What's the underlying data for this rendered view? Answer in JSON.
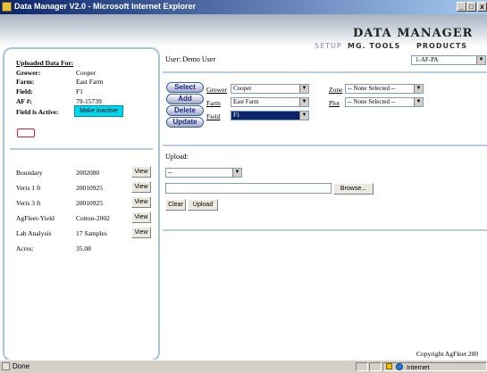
{
  "window": {
    "title": "Data Manager V2.0 - Microsoft Internet Explorer",
    "min": "_",
    "max": "□",
    "close": "x"
  },
  "header": {
    "brand": "Data Manager",
    "nav": [
      "Setup",
      "Mg. Tools",
      "Products"
    ],
    "user_label": "User: Demo User",
    "user_select": "1-AF-PA"
  },
  "summary": {
    "heading": "Uploaded Data For:",
    "rows": [
      {
        "label": "Grower:",
        "value": "Cooper"
      },
      {
        "label": "Farm:",
        "value": "East Farm"
      },
      {
        "label": "Field:",
        "value": "F1"
      },
      {
        "label": "AF #:",
        "value": "79-15739"
      }
    ],
    "active_label": "Field is Active:",
    "active_button": "Make inactive"
  },
  "datasets": [
    {
      "name": "Boundary",
      "value": "2002080",
      "action": "View"
    },
    {
      "name": "Veris 1 ft",
      "value": "20010925",
      "action": "View"
    },
    {
      "name": "Veris 3 ft",
      "value": "20010925",
      "action": "View"
    },
    {
      "name": "AgFleet-Yield",
      "value": "Cotton-2002",
      "action": "View"
    },
    {
      "name": "Lab Analysis",
      "value": "17 Samples",
      "action": "View"
    },
    {
      "name": "Acres:",
      "value": "35.08",
      "action": ""
    }
  ],
  "actions": [
    "Select",
    "Add",
    "Delete",
    "Update"
  ],
  "fields": {
    "grower_label": "Grower",
    "grower_value": "Cooper",
    "farm_label": "Farm",
    "farm_value": "East Farm",
    "field_label": "Field",
    "field_value": "F1",
    "zone_label": "Zone",
    "zone_value": "-- None Selected --",
    "plot_label": "Plot",
    "plot_value": "-- None Selected --"
  },
  "upload": {
    "label": "Upload:",
    "type_value": "--",
    "file_value": "",
    "browse": "Browse...",
    "clear": "Clear",
    "upload": "Upload"
  },
  "footer": {
    "copyright": "Copyright AgFleet 200"
  },
  "statusbar": {
    "status": "Done",
    "zone": "Internet"
  },
  "arrow": "▼"
}
